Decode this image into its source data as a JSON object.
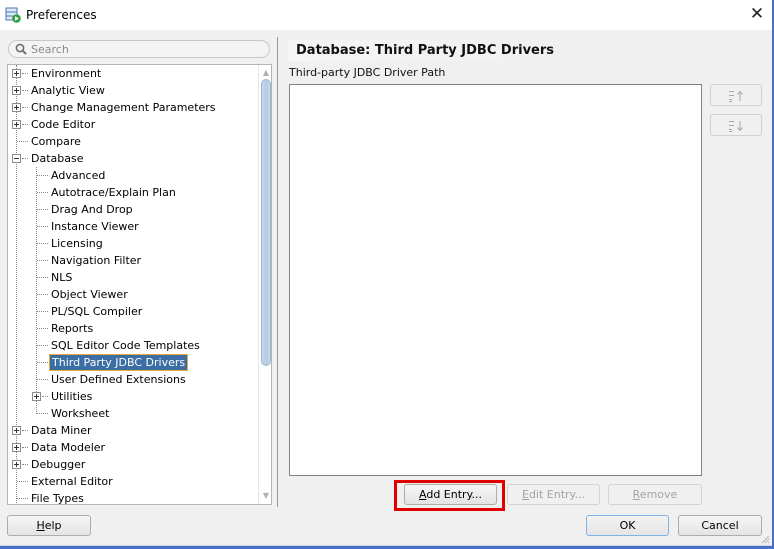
{
  "window": {
    "title": "Preferences",
    "app_icon": "preferences-app-icon",
    "close_icon": "close-icon"
  },
  "search": {
    "placeholder": "Search",
    "value": "",
    "icon": "search-icon"
  },
  "tree": {
    "items": [
      {
        "label": "Environment",
        "level": 0,
        "expander": "plus"
      },
      {
        "label": "Analytic View",
        "level": 0,
        "expander": "plus"
      },
      {
        "label": "Change Management Parameters",
        "level": 0,
        "expander": "plus"
      },
      {
        "label": "Code Editor",
        "level": 0,
        "expander": "plus"
      },
      {
        "label": "Compare",
        "level": 0,
        "expander": "none"
      },
      {
        "label": "Database",
        "level": 0,
        "expander": "minus"
      },
      {
        "label": "Advanced",
        "level": 1,
        "expander": "none"
      },
      {
        "label": "Autotrace/Explain Plan",
        "level": 1,
        "expander": "none"
      },
      {
        "label": "Drag And Drop",
        "level": 1,
        "expander": "none"
      },
      {
        "label": "Instance Viewer",
        "level": 1,
        "expander": "none"
      },
      {
        "label": "Licensing",
        "level": 1,
        "expander": "none"
      },
      {
        "label": "Navigation Filter",
        "level": 1,
        "expander": "none"
      },
      {
        "label": "NLS",
        "level": 1,
        "expander": "none"
      },
      {
        "label": "Object Viewer",
        "level": 1,
        "expander": "none"
      },
      {
        "label": "PL/SQL Compiler",
        "level": 1,
        "expander": "none"
      },
      {
        "label": "Reports",
        "level": 1,
        "expander": "none"
      },
      {
        "label": "SQL Editor Code Templates",
        "level": 1,
        "expander": "none"
      },
      {
        "label": "Third Party JDBC Drivers",
        "level": 1,
        "expander": "none",
        "selected": true
      },
      {
        "label": "User Defined Extensions",
        "level": 1,
        "expander": "none"
      },
      {
        "label": "Utilities",
        "level": 1,
        "expander": "plus"
      },
      {
        "label": "Worksheet",
        "level": 1,
        "expander": "none"
      },
      {
        "label": "Data Miner",
        "level": 0,
        "expander": "plus"
      },
      {
        "label": "Data Modeler",
        "level": 0,
        "expander": "plus"
      },
      {
        "label": "Debugger",
        "level": 0,
        "expander": "plus"
      },
      {
        "label": "External Editor",
        "level": 0,
        "expander": "none"
      },
      {
        "label": "File Types",
        "level": 0,
        "expander": "none"
      }
    ]
  },
  "panel": {
    "title": "Database: Third Party JDBC Drivers",
    "path_label": "Third-party JDBC Driver Path",
    "path_entries": [],
    "move_up_icon": "move-up-icon",
    "move_down_icon": "move-down-icon",
    "add_entry": {
      "label": "Add Entry...",
      "mnemonic": "A",
      "rest": "dd Entry...",
      "enabled": true,
      "highlighted": true
    },
    "edit_entry": {
      "label": "Edit Entry...",
      "mnemonic": "E",
      "rest": "dit Entry...",
      "enabled": false
    },
    "remove": {
      "label": "Remove",
      "mnemonic": "R",
      "rest": "emove",
      "enabled": false
    }
  },
  "footer": {
    "help": {
      "label": "Help",
      "mnemonic": "H",
      "rest": "elp"
    },
    "ok": {
      "label": "OK"
    },
    "cancel": {
      "label": "Cancel"
    }
  },
  "colors": {
    "selection_bg": "#3a6ea5",
    "selection_border": "#e8a838",
    "highlight_box": "#e00000",
    "frame": "#4a6fc9"
  }
}
